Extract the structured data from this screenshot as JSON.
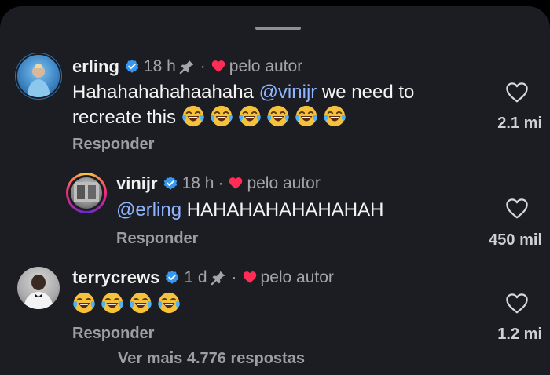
{
  "sheet": {
    "background": "#1c1d22",
    "mention_color": "#8fb5ff",
    "heart_color": "#ff2d55",
    "verified_color": "#3897f0"
  },
  "comments": [
    {
      "username": "erling",
      "time": "18 h",
      "pinned": true,
      "author_label": "pelo autor",
      "text_before": "Hahahahahahaahaha ",
      "mention": "@vinijr",
      "text_after": " we need to recreate this",
      "emojis": [
        "face-with-tears-of-joy",
        "face-with-tears-of-joy",
        "face-with-tears-of-joy",
        "face-with-tears-of-joy",
        "face-with-tears-of-joy",
        "face-with-tears-of-joy"
      ],
      "reply_label": "Responder",
      "likes": "2.1 mi"
    },
    {
      "username": "vinijr",
      "time": "18 h",
      "pinned": false,
      "author_label": "pelo autor",
      "mention": "@erling",
      "text_after": " HAHAHAHAHAHAHAH",
      "reply_label": "Responder",
      "likes": "450 mil"
    },
    {
      "username": "terrycrews",
      "time": "1 d",
      "pinned": true,
      "author_label": "pelo autor",
      "emojis": [
        "face-with-tears-of-joy",
        "face-with-tears-of-joy",
        "face-with-tears-of-joy",
        "face-with-tears-of-joy"
      ],
      "reply_label": "Responder",
      "likes": "1.2 mi"
    }
  ],
  "view_more": "Ver mais 4.776 respostas"
}
